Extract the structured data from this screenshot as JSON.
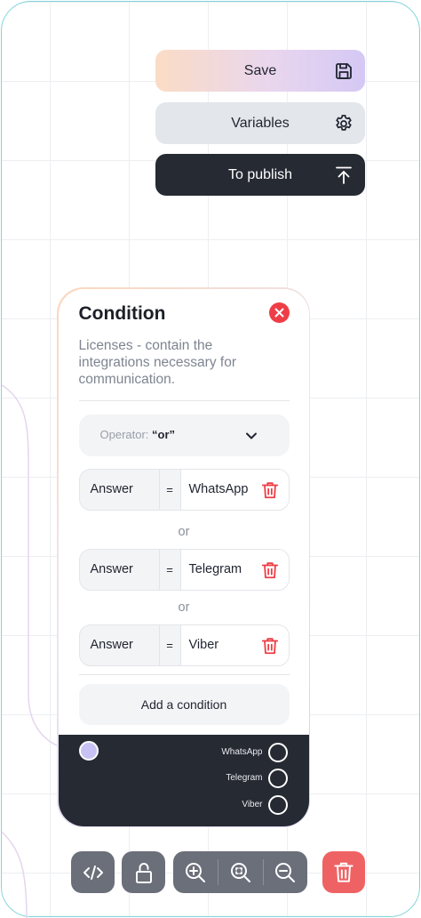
{
  "toolbar_top": {
    "save_label": "Save",
    "variables_label": "Variables",
    "publish_label": "To publish"
  },
  "condition": {
    "title": "Condition",
    "description": "Licenses - contain the integrations necessary for communication.",
    "operator_prefix": "Operator:",
    "operator_value": "“or”",
    "rules": [
      {
        "field": "Answer",
        "op": "=",
        "value": "WhatsApp"
      },
      {
        "field": "Answer",
        "op": "=",
        "value": "Telegram"
      },
      {
        "field": "Answer",
        "op": "=",
        "value": "Viber"
      }
    ],
    "or_label": "or",
    "add_label": "Add a condition",
    "outputs": [
      "WhatsApp",
      "Telegram",
      "Viber"
    ]
  },
  "colors": {
    "accent_frame": "#7fd4dc",
    "delete_red": "#ee3d46",
    "dark": "#252a33",
    "port_fill": "#c8c2f4"
  },
  "icons": {
    "save": "floppy-disk-icon",
    "variables": "gear-icon",
    "publish": "upload-icon",
    "close": "close-icon",
    "chevron": "chevron-down-icon",
    "trash": "trash-icon",
    "code": "code-icon",
    "lock": "lock-icon",
    "zoom_in": "zoom-in-icon",
    "zoom_fit": "zoom-fit-icon",
    "zoom_out": "zoom-out-icon"
  }
}
